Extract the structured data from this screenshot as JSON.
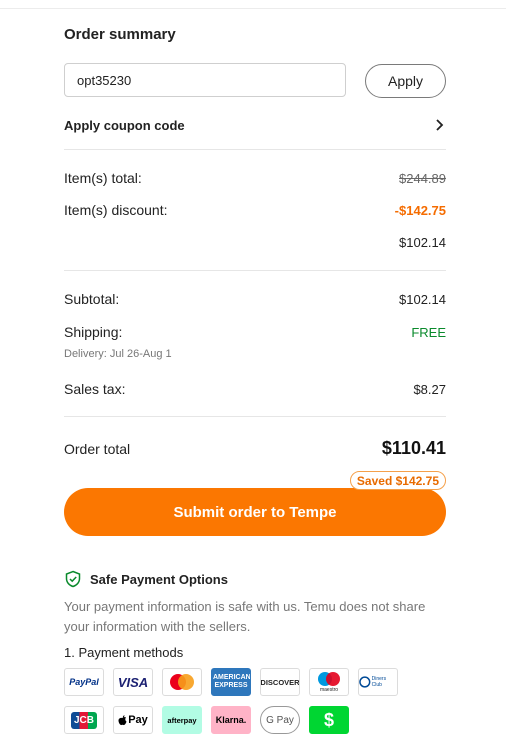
{
  "summary": {
    "title": "Order summary",
    "coupon_value": "opt35230",
    "apply_label": "Apply",
    "coupon_link_label": "Apply coupon code"
  },
  "pricing": {
    "items_total_label": "Item(s) total:",
    "items_total_value": "$244.89",
    "items_discount_label": "Item(s) discount:",
    "items_discount_value": "-$142.75",
    "after_discount_value": "$102.14",
    "subtotal_label": "Subtotal:",
    "subtotal_value": "$102.14",
    "shipping_label": "Shipping:",
    "shipping_value": "FREE",
    "delivery_text": "Delivery: Jul 26-Aug 1",
    "sales_tax_label": "Sales tax:",
    "sales_tax_value": "$8.27",
    "order_total_label": "Order total",
    "order_total_value": "$110.41",
    "saved_label": "Saved $142.75"
  },
  "submit": {
    "label": "Submit order to Tempe"
  },
  "safety": {
    "title": "Safe Payment Options",
    "description": "Your payment information is safe with us. Temu does not share your information with the sellers.",
    "methods_title": "1. Payment methods"
  },
  "payment_methods": [
    {
      "icon": "paypal-icon",
      "text": "PayPal"
    },
    {
      "icon": "visa-icon",
      "text": "VISA"
    },
    {
      "icon": "mastercard-icon",
      "text": ""
    },
    {
      "icon": "amex-icon",
      "text": "AMERICAN EXPRESS"
    },
    {
      "icon": "discover-icon",
      "text": "DISCOVER"
    },
    {
      "icon": "maestro-icon",
      "text": "maestro"
    },
    {
      "icon": "diners-club-icon",
      "text": "Diners Club"
    },
    {
      "icon": "jcb-icon",
      "text": "JCB"
    },
    {
      "icon": "apple-pay-icon",
      "text": "Pay"
    },
    {
      "icon": "afterpay-icon",
      "text": "afterpay"
    },
    {
      "icon": "klarna-icon",
      "text": "Klarna."
    },
    {
      "icon": "google-pay-icon",
      "text": "G Pay"
    },
    {
      "icon": "cash-app-icon",
      "text": "$"
    }
  ],
  "colors": {
    "accent": "#fb7701",
    "discount": "#f56c00",
    "free": "#0a8a2c",
    "shield": "#0a8a2c"
  }
}
